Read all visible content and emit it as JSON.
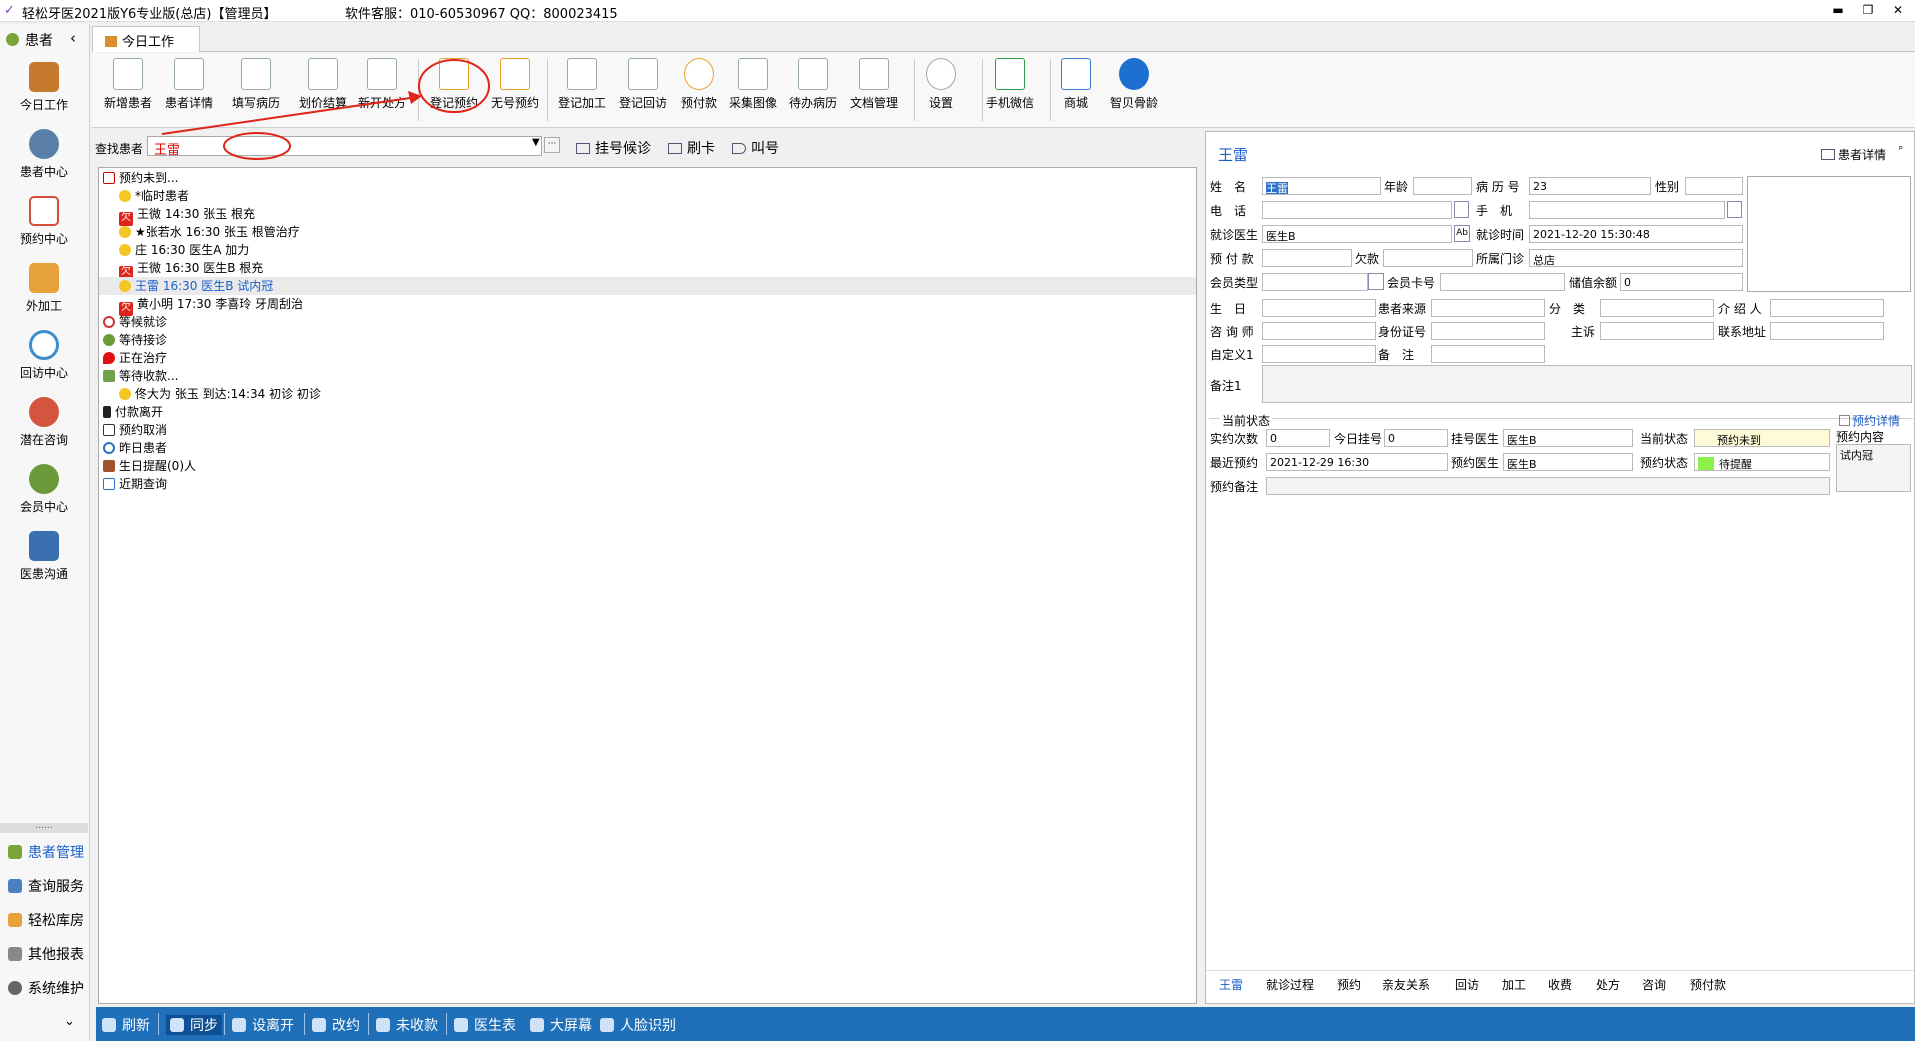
{
  "window": {
    "title": "轻松牙医2021版Y6专业版(总店)【管理员】",
    "service": "软件客服：010-60530967  QQ：800023415"
  },
  "sidebar": {
    "header": "患者",
    "items": [
      {
        "label": "今日工作"
      },
      {
        "label": "患者中心"
      },
      {
        "label": "预约中心"
      },
      {
        "label": "外加工"
      },
      {
        "label": "回访中心"
      },
      {
        "label": "潜在咨询"
      },
      {
        "label": "会员中心"
      },
      {
        "label": "医患沟通"
      }
    ],
    "dots": "......",
    "bottom": [
      {
        "label": "患者管理"
      },
      {
        "label": "查询服务"
      },
      {
        "label": "轻松库房"
      },
      {
        "label": "其他报表"
      },
      {
        "label": "系统维护"
      }
    ]
  },
  "tab": {
    "label": "今日工作"
  },
  "toolbar": {
    "buttons": [
      {
        "label": "新增患者"
      },
      {
        "label": "患者详情"
      },
      {
        "label": "填写病历"
      },
      {
        "label": "划价结算"
      },
      {
        "label": "新开处方"
      },
      {
        "label": "登记预约"
      },
      {
        "label": "无号预约"
      },
      {
        "label": "登记加工"
      },
      {
        "label": "登记回访"
      },
      {
        "label": "预付款"
      },
      {
        "label": "采集图像"
      },
      {
        "label": "待办病历"
      },
      {
        "label": "文档管理"
      },
      {
        "label": "设置"
      },
      {
        "label": "手机微信"
      },
      {
        "label": "商城"
      },
      {
        "label": "智贝骨龄"
      }
    ]
  },
  "search": {
    "label": "查找患者",
    "value": "王雷",
    "buttons": [
      {
        "label": "挂号候诊"
      },
      {
        "label": "刷卡"
      },
      {
        "label": "叫号"
      }
    ]
  },
  "tree": {
    "items": [
      {
        "text": "预约未到..."
      },
      {
        "text": "*临时患者"
      },
      {
        "text": "王微 14:30 张玉 根充"
      },
      {
        "text": "★张若水 16:30 张玉 根管治疗"
      },
      {
        "text": "庄 16:30 医生A 加力"
      },
      {
        "text": "王微 16:30 医生B 根充"
      },
      {
        "text": "王雷 16:30 医生B 试内冠"
      },
      {
        "text": "黄小明 17:30 李喜玲 牙周刮治"
      },
      {
        "text": "等候就诊"
      },
      {
        "text": "等待接诊"
      },
      {
        "text": "正在治疗"
      },
      {
        "text": "等待收款..."
      },
      {
        "text": "佟大为  张玉 到达:14:34 初诊 初诊"
      },
      {
        "text": "付款离开"
      },
      {
        "text": "预约取消"
      },
      {
        "text": "昨日患者"
      },
      {
        "text": "生日提醒(0)人"
      },
      {
        "text": "近期查询"
      }
    ],
    "miss_badge": "欠"
  },
  "patient": {
    "name": "王雷",
    "detail_button": "患者详情",
    "labels": {
      "name": "姓　名",
      "age": "年龄",
      "record_no": "病 历 号",
      "gender": "性别",
      "phone": "电　话",
      "mobile": "手　机",
      "doctor": "就诊医生",
      "visit_time": "就诊时间",
      "prepay": "预 付 款",
      "debt": "欠款",
      "clinic": "所属门诊",
      "member_type": "会员类型",
      "member_card": "会员卡号",
      "balance": "储值余额",
      "birthday": "生　日",
      "source": "患者来源",
      "category": "分　类",
      "referrer": "介 绍 人",
      "consultant": "咨 询 师",
      "id_no": "身份证号",
      "complaint": "主诉",
      "address": "联系地址",
      "custom1": "自定义1",
      "remark": "备　注",
      "remark1": "备注1"
    },
    "values": {
      "name": "王雷",
      "record_no": "23",
      "doctor": "医生B",
      "visit_time": "2021-12-20 15:30:48",
      "clinic": "总店",
      "balance": "0"
    },
    "ab_btn": "Ab"
  },
  "status": {
    "title": "当前状态",
    "link": "预约详情",
    "labels": {
      "visits": "实约次数",
      "today_reg": "今日挂号",
      "reg_doctor": "挂号医生",
      "cur_status": "当前状态",
      "recent": "最近预约",
      "appt_doctor": "预约医生",
      "appt_status": "预约状态",
      "appt_remark": "预约备注",
      "appt_content": "预约内容"
    },
    "values": {
      "visits": "0",
      "today_reg": "0",
      "reg_doctor": "医生B",
      "cur_status": "预约未到",
      "recent": "2021-12-29 16:30",
      "appt_doctor": "医生B",
      "appt_status": "待提醒",
      "appt_content": "试内冠"
    },
    "colors": {
      "cur_status": "#fffbd8",
      "appt_status": "#8cf04a"
    }
  },
  "bottom_tabs": [
    {
      "label": "王雷"
    },
    {
      "label": "就诊过程"
    },
    {
      "label": "预约"
    },
    {
      "label": "亲友关系"
    },
    {
      "label": "回访"
    },
    {
      "label": "加工"
    },
    {
      "label": "收费"
    },
    {
      "label": "处方"
    },
    {
      "label": "咨询"
    },
    {
      "label": "预付款"
    }
  ],
  "statusbar": [
    {
      "label": "刷新"
    },
    {
      "label": "同步"
    },
    {
      "label": "设离开"
    },
    {
      "label": "改约"
    },
    {
      "label": "未收款"
    },
    {
      "label": "医生表"
    },
    {
      "label": "大屏幕"
    },
    {
      "label": "人脸识别"
    }
  ]
}
